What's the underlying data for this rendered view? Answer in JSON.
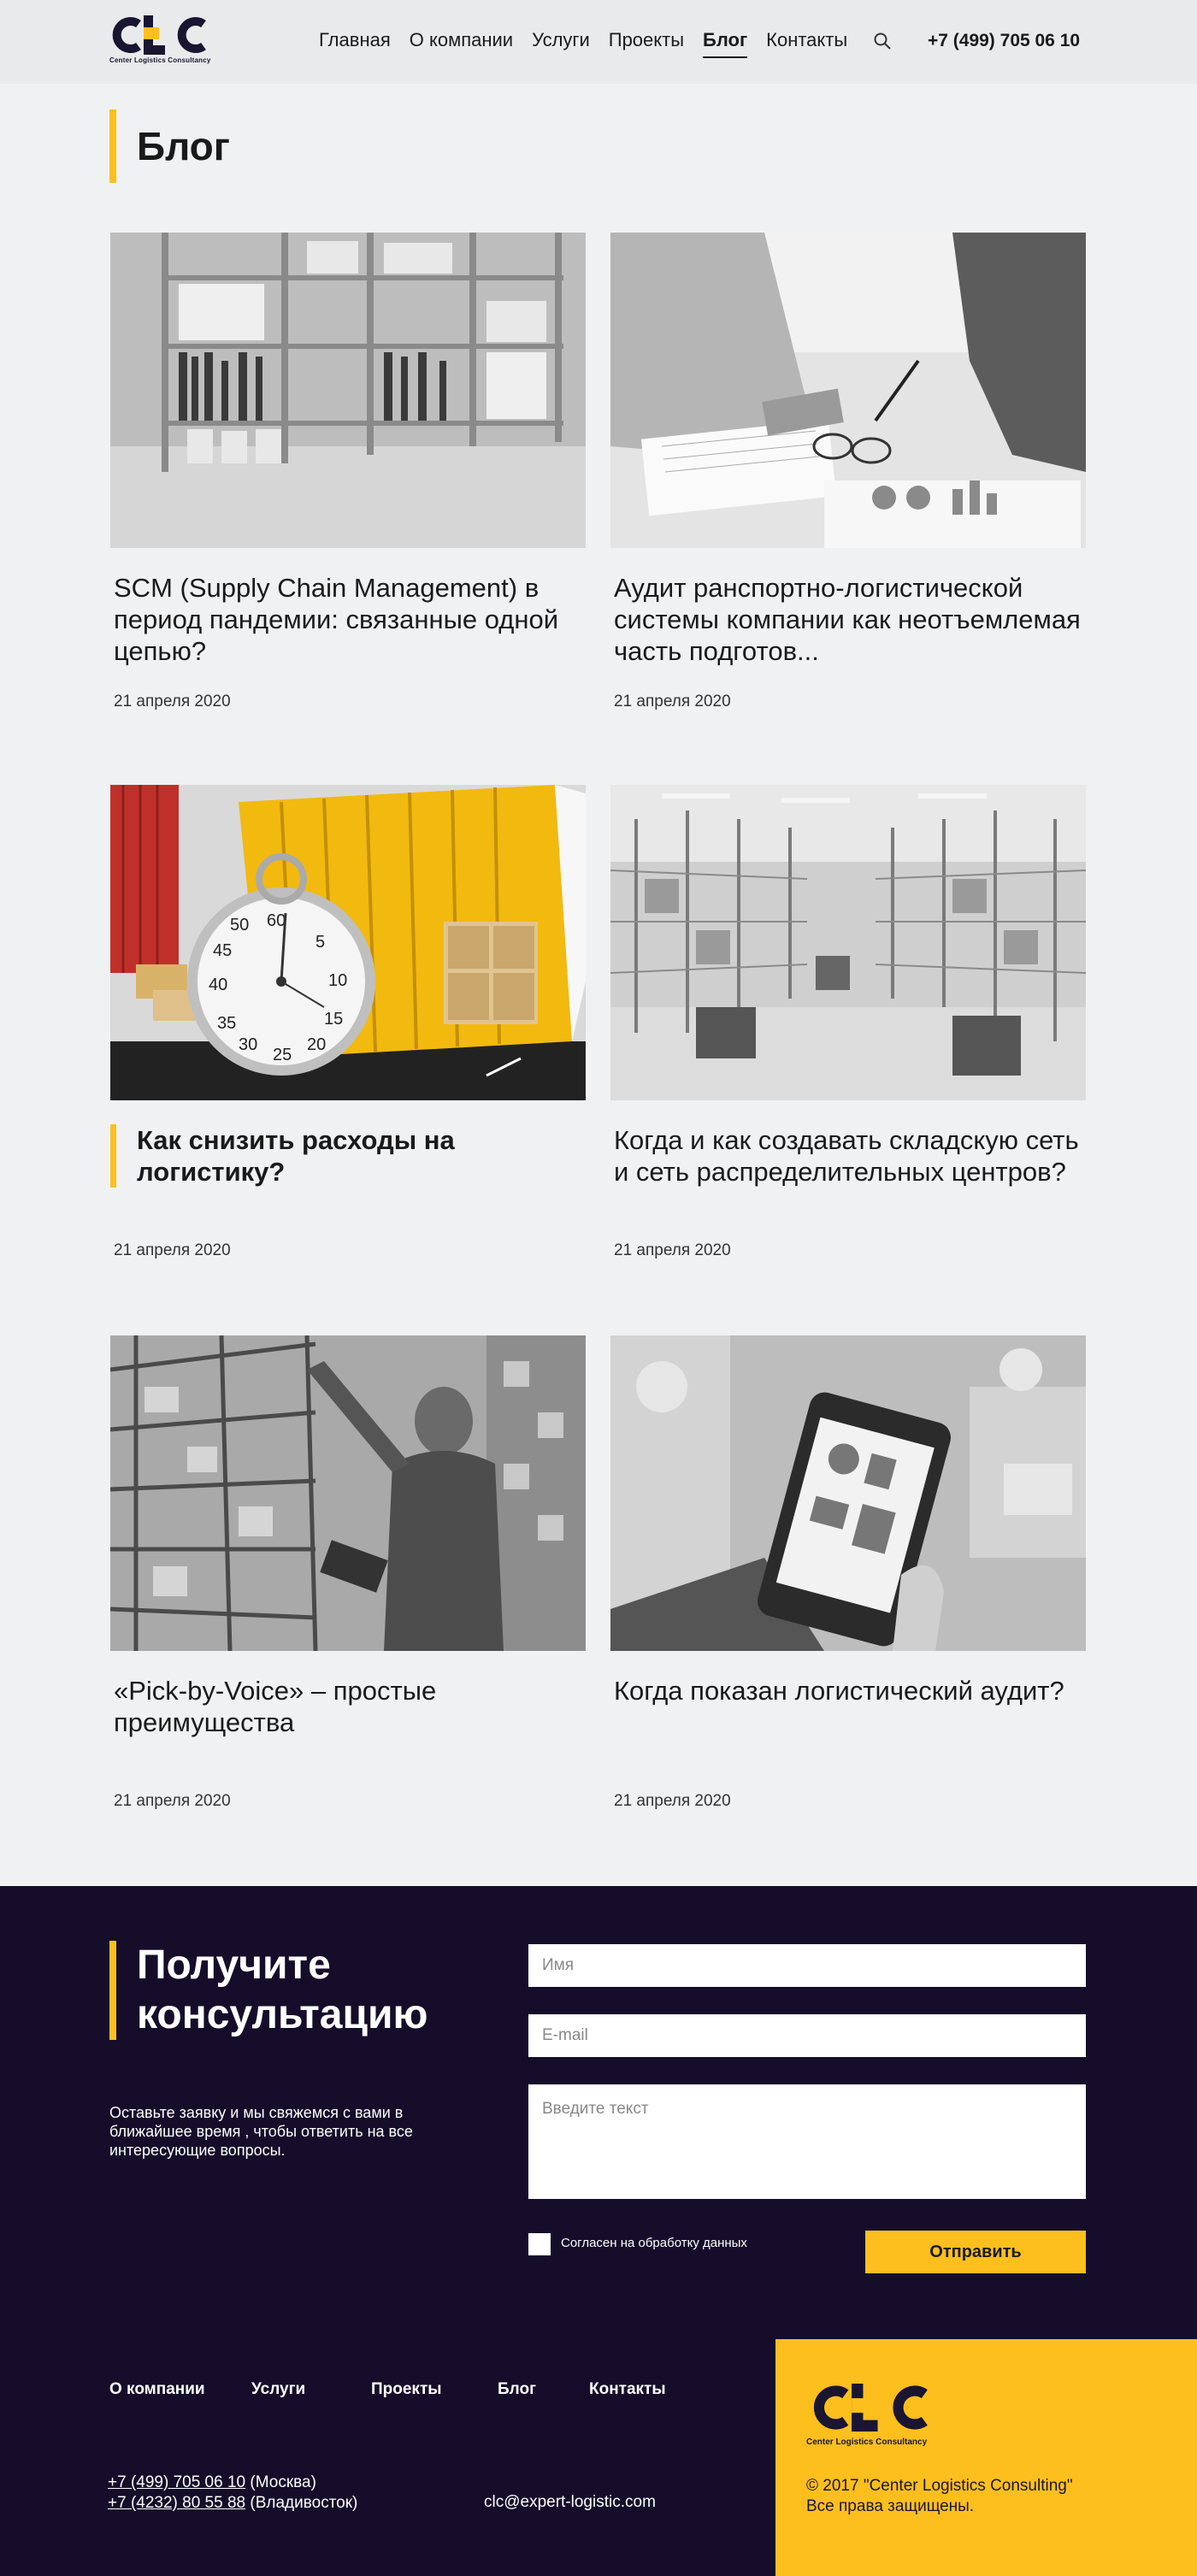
{
  "header": {
    "logo_sub": "Center Logistics Consultancy",
    "nav": [
      "Главная",
      "О компании",
      "Услуги",
      "Проекты",
      "Блог",
      "Контакты"
    ],
    "active": "Блог",
    "phone": "+7 (499) 705 06 10"
  },
  "page": {
    "title": "Блог"
  },
  "posts": [
    {
      "title": "SCM (Supply Chain Management) в период пандемии: связанные одной цепью?",
      "date": "21 апреля 2020"
    },
    {
      "title": "Аудит ранспортно-логистической системы компании как неотъемлемая часть подготов...",
      "date": "21 апреля 2020"
    },
    {
      "title": "Как снизить расходы на логистику?",
      "date": "21 апреля 2020"
    },
    {
      "title": "Когда и как создавать складскую сеть и сеть распределительных центров?",
      "date": "21 апреля 2020"
    },
    {
      "title": "«Pick-by-Voice» – простые преимущества",
      "date": "21 апреля 2020"
    },
    {
      "title": "Когда показан логистический аудит?",
      "date": "21 апреля 2020"
    }
  ],
  "consult": {
    "title_line1": "Получите",
    "title_line2": "консультацию",
    "desc": "Оставьте заявку и мы свяжемся с вами в ближайшее время , чтобы ответить на все интересующие вопросы.",
    "name_placeholder": "Имя",
    "email_placeholder": "E-mail",
    "text_placeholder": "Введите текст",
    "consent": "Согласен на обработку данных",
    "submit": "Отправить"
  },
  "footer": {
    "nav": [
      "О компании",
      "Услуги",
      "Проекты",
      "Блог",
      "Контакты"
    ],
    "phone1": "+7 (499) 705 06 10",
    "phone1_city": " (Москва)",
    "phone2": "+7 (4232) 80 55 88",
    "phone2_city": " (Владивосток)",
    "email": "clc@expert-logistic.com",
    "logo_sub": "Center Logistics Consultancy",
    "copyright": "© 2017 \"Center Logistics Consulting\"",
    "rights": "Все права защищены."
  },
  "colors": {
    "accent": "#fcbf1e",
    "dark": "#160d2a",
    "bg": "#f0f1f3"
  }
}
